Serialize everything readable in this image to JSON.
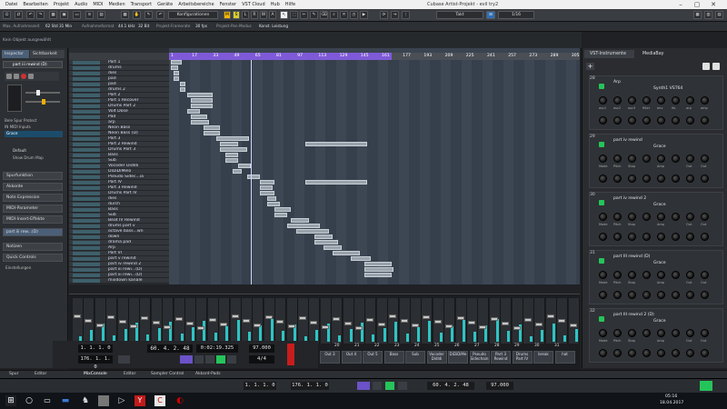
{
  "window": {
    "title": "Cubase Artist-Projekt - evil try2"
  },
  "menu": [
    "Datei",
    "Bearbeiten",
    "Projekt",
    "Audio",
    "MIDI",
    "Medien",
    "Transport",
    "Geräte",
    "Arbeitsbereiche",
    "Fenster",
    "VST Cloud",
    "Hub",
    "Hilfe"
  ],
  "toolbar": {
    "config": "Konfigurationen",
    "buttons": [
      "M",
      "S",
      "L",
      "R",
      "W",
      "A"
    ],
    "grid_mode": "Takt",
    "quantize": "1/16",
    "dropdown2": "Takt"
  },
  "infoline": [
    "Max. Aufnahmezeit",
    "62 Std 31 Min",
    "Aufnahmeformat",
    "44.1 kHz",
    "32 Bit",
    "Projekt-Framerate",
    "30 fps",
    "Projekt-Pan-Modus",
    "Konst. Leistung"
  ],
  "status": "Kein Objekt ausgewählt",
  "inspector": {
    "tabs": [
      "Inspector",
      "Sichtbarkeit"
    ],
    "track_name": "part iii rewind (D)",
    "rows": [
      "Bele Spur Protect",
      "IN MIDI Inputs",
      "Grace",
      "Default",
      "Show Drum Map"
    ],
    "sections": [
      "Spurfunktion",
      "Akkorde",
      "Note Expression",
      "MIDI-Parameter",
      "MIDI-Insert-Effekte",
      "part iii rew...(D)",
      "Notizen",
      "Quick Controls",
      "Einstellungen"
    ]
  },
  "tracks": [
    "Part 1",
    "drums",
    "dies",
    "pad",
    "pad",
    "drums 2",
    "Part 2",
    "Part 1 Recover",
    "Drums Part 2",
    "Volt Dose",
    "Pad",
    "arp",
    "Neon Bass",
    "Neon Bass (D)",
    "Part 3",
    "Part 2 Rewind",
    "Drums Part 3",
    "Bass",
    "Sub",
    "Vocoder Didldi",
    "DiDiDiMelo",
    "Pseudo Sidec...ia",
    "Part IV",
    "Part 3 Rewind",
    "Drums Part IV",
    "dies",
    "durch",
    "Bass",
    "Sub",
    "Beat IV Rewind",
    "drums part v",
    "octave bass...wn",
    "down",
    "drama pad",
    "Arp",
    "Part VI",
    "part v rewind",
    "part iv rewind 2",
    "part iii rewi...(D)",
    "part iii rewi...(D)",
    "mixdown kanäle"
  ],
  "ruler": [
    "1",
    "17",
    "33",
    "49",
    "65",
    "81",
    "97",
    "113",
    "129",
    "145",
    "161",
    "177",
    "193",
    "209",
    "225",
    "241",
    "257",
    "273",
    "289",
    "305"
  ],
  "right_panel": {
    "tabs": [
      "VST-Instrumente",
      "MediaBay"
    ],
    "slots": [
      {
        "num": "28",
        "name": "Arp",
        "sub": "Synth1 VST64"
      },
      {
        "num": "29",
        "name": "part iv rewind",
        "sub": "Grace"
      },
      {
        "num": "30",
        "name": "part iv rewind 2",
        "sub": "Grace"
      },
      {
        "num": "31",
        "name": "part III rewind (D)",
        "sub": "Grace"
      },
      {
        "num": "32",
        "name": "part III rewind 2 (D)",
        "sub": "Grace"
      }
    ],
    "knob_labels": [
      "osc1",
      "osc2",
      "osc3",
      "filter",
      "env",
      "lfo",
      "arp",
      "amp"
    ],
    "knob_labels2": [
      "Mode",
      "Pitch",
      "Stop",
      "",
      "Amp",
      "",
      "Out",
      "Out"
    ]
  },
  "mixer": {
    "channel_numbers": [
      "20",
      "21",
      "22",
      "23",
      "24",
      "25",
      "26",
      "27",
      "28",
      "29",
      "30",
      "31"
    ],
    "channel_names": [
      "Out 3",
      "Out 4",
      "Out 5",
      "Bass",
      "Sub",
      "Vocoder Didldi",
      "DiDiDiMe",
      "Pseudo Sidechain",
      "Part 3 Rewind",
      "Drums Part IV",
      "break",
      "hat"
    ]
  },
  "transport": {
    "left_locator": "1. 1. 1. 0",
    "right_locator": "176. 1. 1. 0",
    "position_bars": "60. 4. 2. 48",
    "position_time": "0:02:19.325",
    "tempo": "97.000",
    "signature": "4/4"
  },
  "bottom_tabs": [
    "Spur",
    "Editor",
    "MixConsole",
    "Editor",
    "Sampler Control",
    "Akkord-Pads"
  ],
  "transbar": {
    "locator_left": "1. 1. 1. 0",
    "locator_right": "176. 1. 1. 0",
    "position": "60. 4. 2. 48",
    "tempo": "97.000"
  },
  "taskbar": {
    "time": "05:16",
    "date": "18.04.2017"
  },
  "colors": {
    "ruler_selection": "#7f5ad8",
    "accent_green": "#25c45a",
    "meter": "#2ec4c4",
    "part": "#9aa3ac"
  }
}
